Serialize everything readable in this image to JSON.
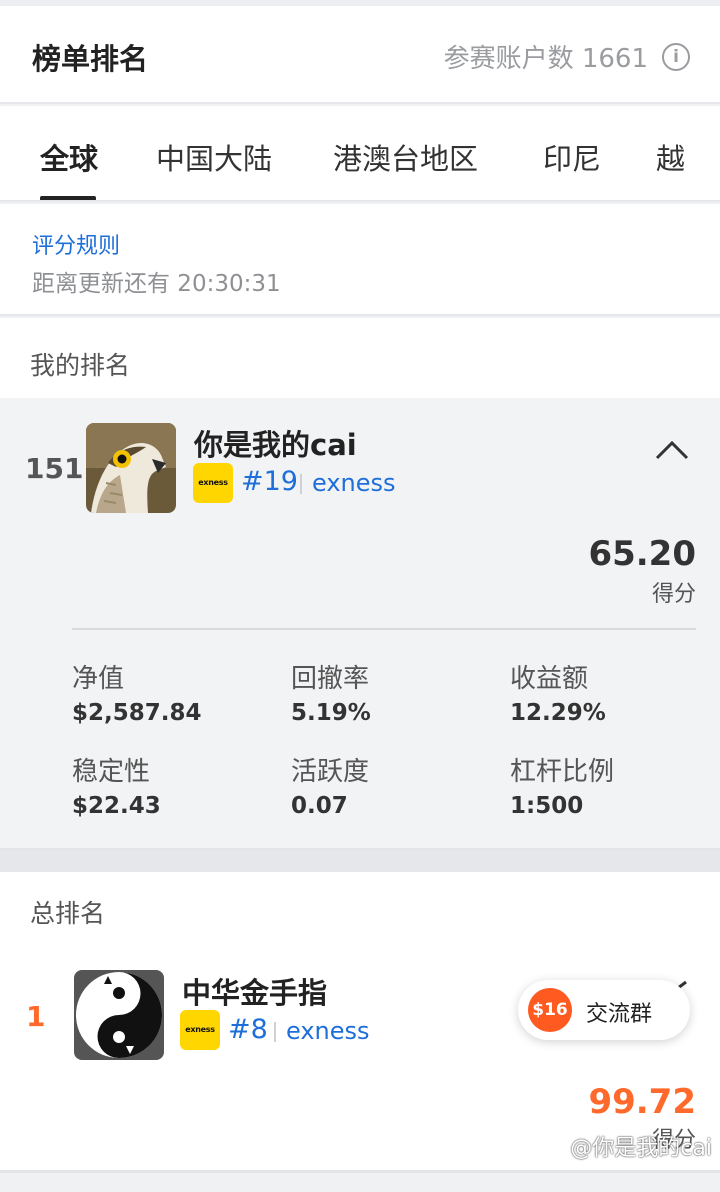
{
  "header": {
    "title": "榜单排名",
    "count_label": "参赛账户数 1661",
    "info_glyph": "i"
  },
  "tabs": [
    "全球",
    "中国大陆",
    "港澳台地区",
    "印尼",
    "越"
  ],
  "rules": {
    "link": "评分规则",
    "timer": "距离更新还有 20:30:31"
  },
  "my_ranking": {
    "section_label": "我的排名",
    "rank": "151",
    "name": "你是我的cai",
    "broker_logo": "exness",
    "broker_rank": "#19",
    "broker": "exness",
    "score": "65.20",
    "score_label": "得分",
    "stats": [
      {
        "label": "净值",
        "value": "$2,587.84"
      },
      {
        "label": "回撤率",
        "value": "5.19%"
      },
      {
        "label": "收益额",
        "value": "12.29%"
      },
      {
        "label": "稳定性",
        "value": "$22.43"
      },
      {
        "label": "活跃度",
        "value": "0.07"
      },
      {
        "label": "杠杆比例",
        "value": "1:500"
      }
    ]
  },
  "total_ranking": {
    "section_label": "总排名",
    "entries": [
      {
        "rank": "1",
        "name": "中华金手指",
        "broker_logo": "exness",
        "broker_rank": "#8",
        "broker": "exness",
        "score": "99.72",
        "score_label": "得分"
      }
    ]
  },
  "float_button": {
    "icon_text": "$16",
    "label": "交流群"
  },
  "watermark": "@你是我的cai",
  "colors": {
    "accent_blue": "#1e6fd9",
    "rank_orange": "#ff6a2c",
    "badge_yellow": "#ffd600"
  }
}
